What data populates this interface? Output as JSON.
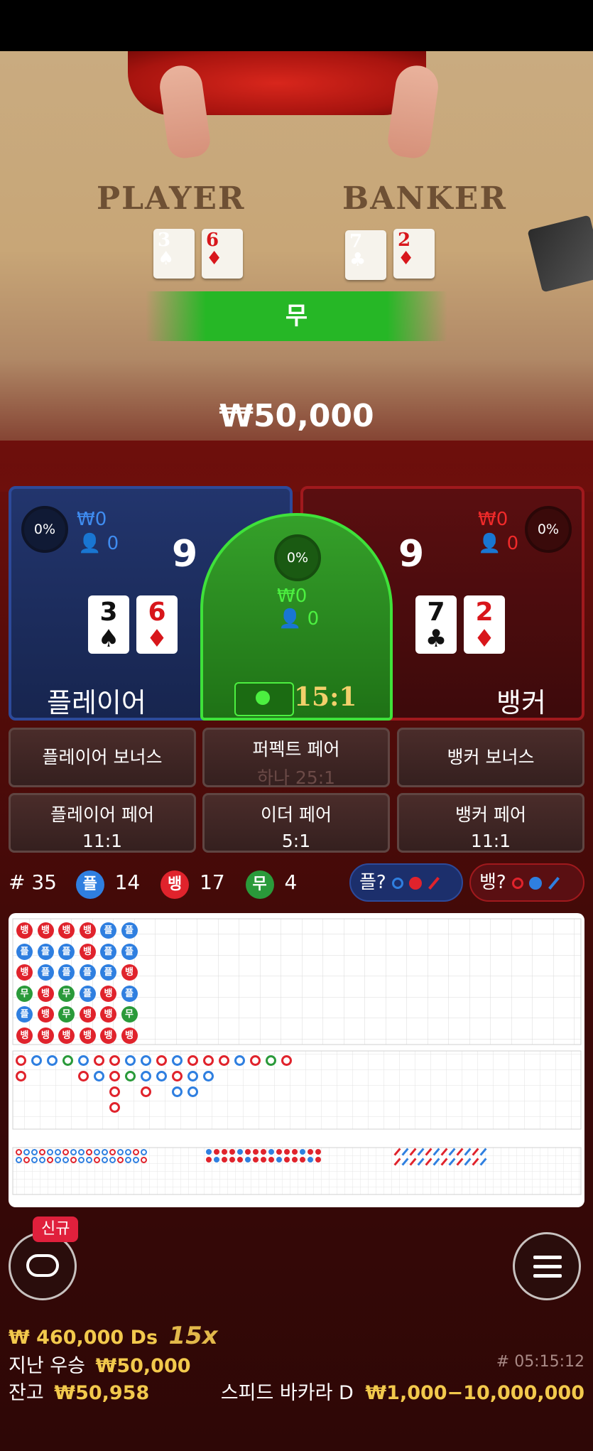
{
  "table": {
    "player_label": "PLAYER",
    "banker_label": "BANKER",
    "player_cards": [
      {
        "v": "3",
        "s": "♠",
        "color": "#111111"
      },
      {
        "v": "6",
        "s": "♦",
        "color": "#d8161b"
      }
    ],
    "banker_cards": [
      {
        "v": "7",
        "s": "♣",
        "color": "#111111"
      },
      {
        "v": "2",
        "s": "♦",
        "color": "#d8161b"
      }
    ]
  },
  "result": {
    "label": "무",
    "amount": "₩50,000"
  },
  "player": {
    "percent": "0%",
    "won": "₩0",
    "count": "0",
    "score": "9",
    "label": "플레이어"
  },
  "banker": {
    "percent": "0%",
    "won": "₩0",
    "count": "0",
    "score": "9",
    "label": "뱅커"
  },
  "tie": {
    "percent": "0%",
    "won": "₩0",
    "count": "0",
    "payout": "15:1"
  },
  "side_bets": [
    {
      "label": "플레이어 보너스",
      "sub": ""
    },
    {
      "label": "퍼펙트 페어",
      "sub": "하나 25:1"
    },
    {
      "label": "뱅커 보너스",
      "sub": ""
    },
    {
      "label": "플레이어 페어",
      "sub": "11:1"
    },
    {
      "label": "이더 페어",
      "sub": "5:1"
    },
    {
      "label": "뱅커 페어",
      "sub": "11:1"
    }
  ],
  "stats": {
    "round": "# 35",
    "player_icon": "플",
    "player_count": "14",
    "banker_icon": "뱅",
    "banker_count": "17",
    "tie_icon": "무",
    "tie_count": "4",
    "player_predict": "플?",
    "banker_predict": "뱅?"
  },
  "colors": {
    "player": "#2f7fe0",
    "banker": "#e0232c",
    "tie": "#2a9a3a"
  },
  "bead_road": [
    [
      "뱅",
      "뱅",
      "뱅",
      "뱅",
      "플",
      "플"
    ],
    [
      "플",
      "플",
      "플",
      "뱅",
      "플",
      "플"
    ],
    [
      "뱅",
      "플",
      "플",
      "플",
      "플",
      "뱅"
    ],
    [
      "무",
      "뱅",
      "무",
      "플",
      "뱅",
      "플"
    ],
    [
      "플",
      "뱅",
      "무",
      "뱅",
      "뱅",
      "무"
    ],
    [
      "뱅",
      "뱅",
      "뱅",
      "뱅",
      "뱅",
      "뱅"
    ]
  ],
  "bottom": {
    "new_badge": "신규",
    "bet_total": "₩ 460,000 Ds",
    "multiplier": "15x",
    "last_win_label": "지난 우승",
    "last_win": "₩50,000",
    "balance_label": "잔고",
    "balance": "₩50,958",
    "round_id": "# 05:15:12",
    "table_name": "스피드 바카라 D",
    "limits": "₩1,000−10,000,000"
  }
}
